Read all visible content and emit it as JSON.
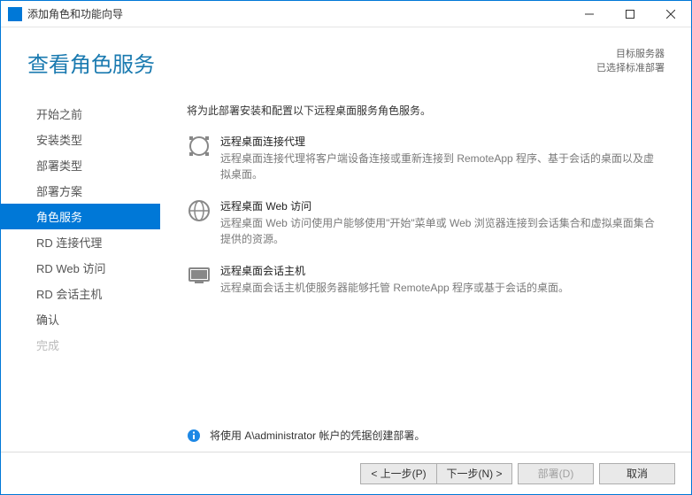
{
  "titlebar": {
    "text": "添加角色和功能向导"
  },
  "header": {
    "title": "查看角色服务",
    "right1": "目标服务器",
    "right2": "已选择标准部署"
  },
  "sidebar": {
    "items": [
      {
        "label": "开始之前"
      },
      {
        "label": "安装类型"
      },
      {
        "label": "部署类型"
      },
      {
        "label": "部署方案"
      },
      {
        "label": "角色服务"
      },
      {
        "label": "RD 连接代理"
      },
      {
        "label": "RD Web 访问"
      },
      {
        "label": "RD 会话主机"
      },
      {
        "label": "确认"
      },
      {
        "label": "完成"
      }
    ]
  },
  "content": {
    "intro": "将为此部署安装和配置以下远程桌面服务角色服务。",
    "roles": [
      {
        "title": "远程桌面连接代理",
        "desc": "远程桌面连接代理将客户端设备连接或重新连接到 RemoteApp 程序、基于会话的桌面以及虚拟桌面。"
      },
      {
        "title": "远程桌面 Web 访问",
        "desc": "远程桌面 Web 访问使用户能够使用\"开始\"菜单或 Web 浏览器连接到会话集合和虚拟桌面集合提供的资源。"
      },
      {
        "title": "远程桌面会话主机",
        "desc": "远程桌面会话主机使服务器能够托管 RemoteApp 程序或基于会话的桌面。"
      }
    ],
    "info": "将使用 A\\administrator 帐户的凭据创建部署。"
  },
  "footer": {
    "prev": "< 上一步(P)",
    "next": "下一步(N) >",
    "deploy": "部署(D)",
    "cancel": "取消"
  }
}
